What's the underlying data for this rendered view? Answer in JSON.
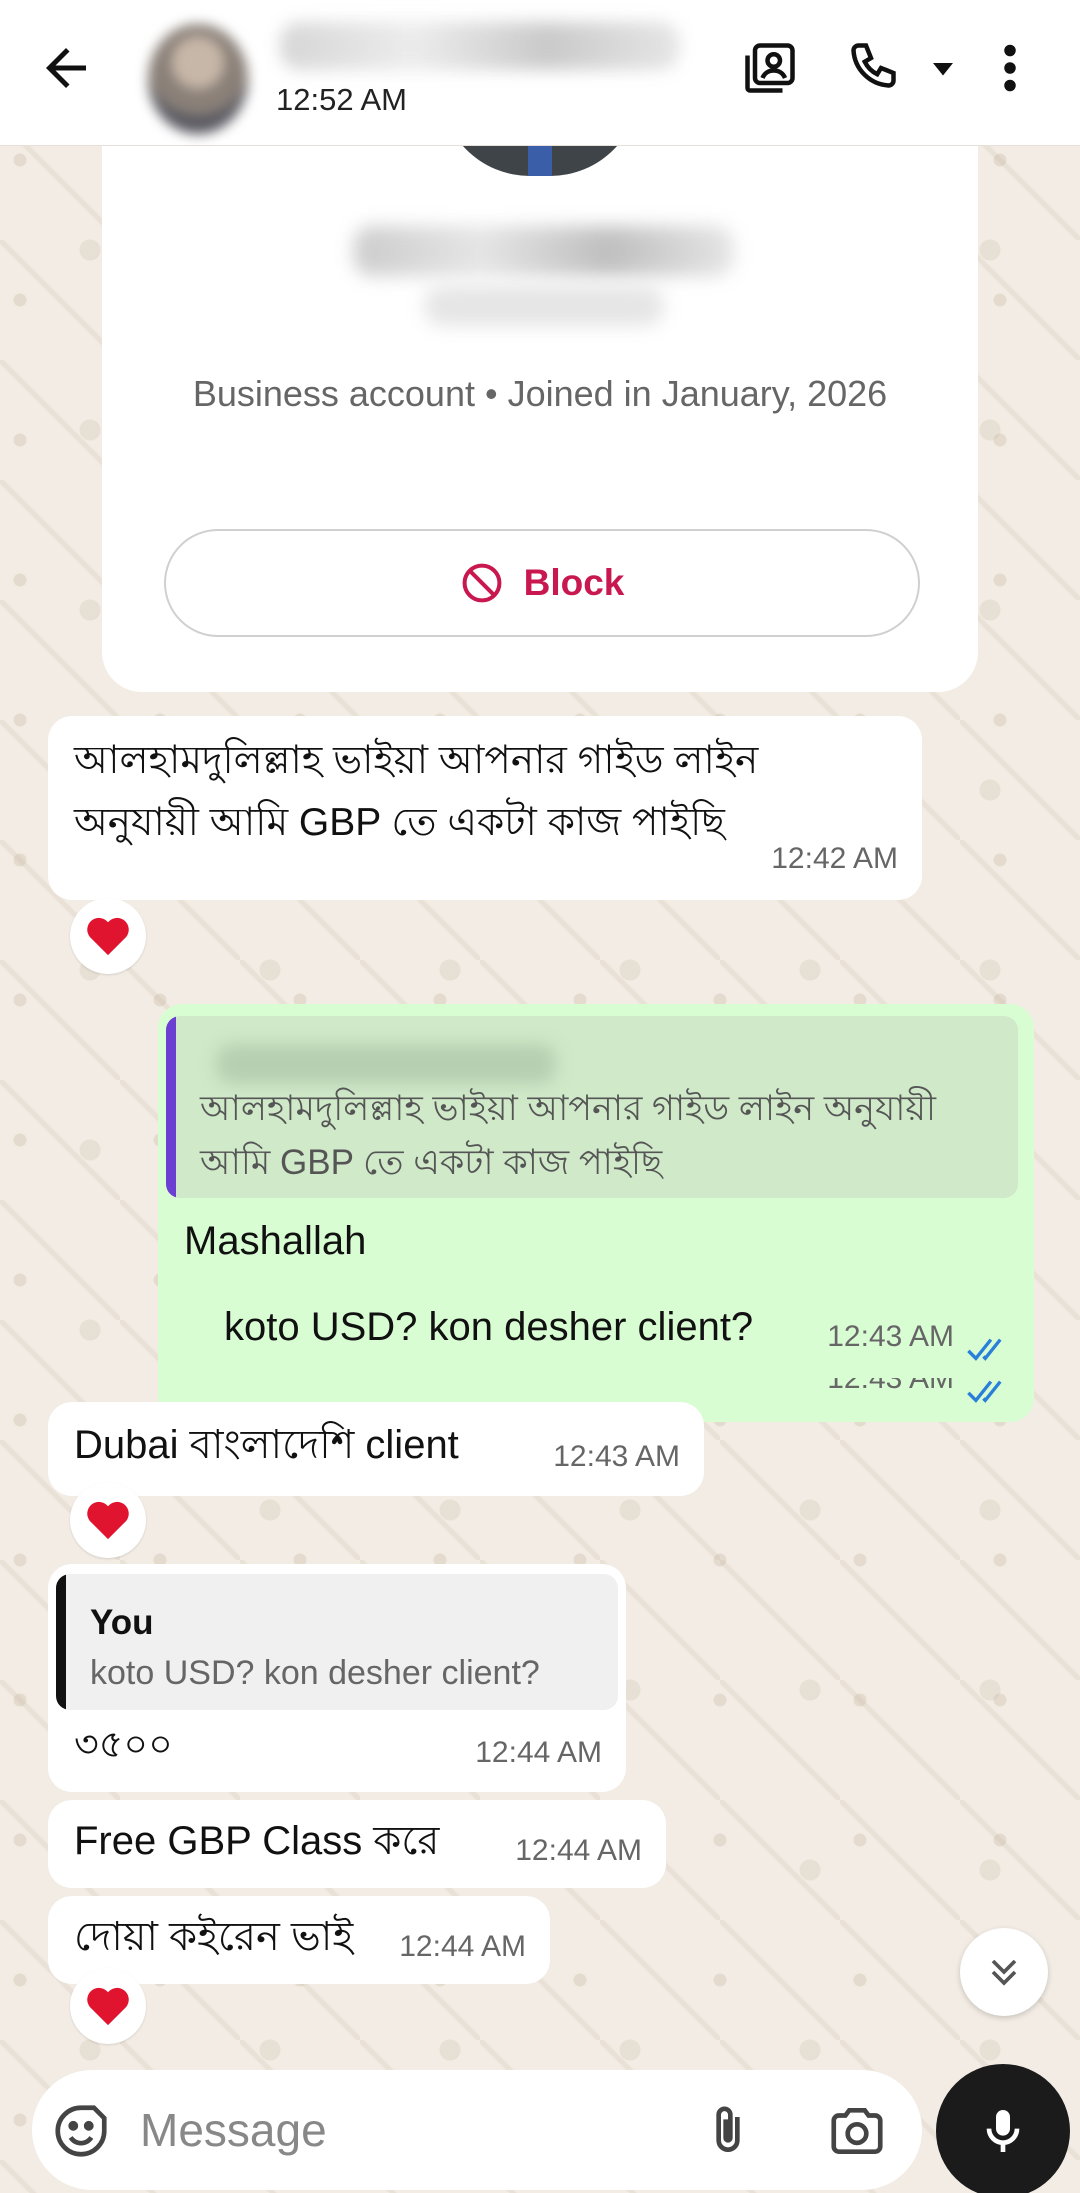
{
  "header": {
    "last_seen": "12:52 AM"
  },
  "profile": {
    "business_text": "Business account • Joined in January, 2026",
    "block_label": "Block"
  },
  "messages": [
    {
      "text": "আলহামদুলিল্লাহ ভাইয়া আপনার গাইড লাইন অনুযায়ী আমি GBP তে একটা কাজ পাইছি",
      "time": "12:42 AM",
      "reaction": "❤️"
    },
    {
      "quote": "আলহামদুলিল্লাহ ভাইয়া আপনার গাইড লাইন অনুযায়ী আমি GBP তে একটা কাজ পাইছি",
      "text": "Mashallah",
      "time": "12:43 AM"
    },
    {
      "text": "koto USD? kon desher client?",
      "time": "12:43 AM"
    },
    {
      "text": "Dubai বাংলাদেশি client",
      "time": "12:43 AM",
      "reaction": "❤️"
    },
    {
      "quote_author": "You",
      "quote": "koto USD? kon desher client?",
      "text": "৩৫০০",
      "time": "12:44 AM"
    },
    {
      "text": "Free GBP Class করে",
      "time": "12:44 AM"
    },
    {
      "text": "দোয়া কইরেন ভাই",
      "time": "12:44 AM",
      "reaction": "❤️"
    }
  ],
  "composer": {
    "placeholder": "Message"
  },
  "colors": {
    "accent_block": "#c8184f",
    "outgoing_bubble": "#d9fdd3",
    "read_ticks": "#2a7fd9"
  }
}
